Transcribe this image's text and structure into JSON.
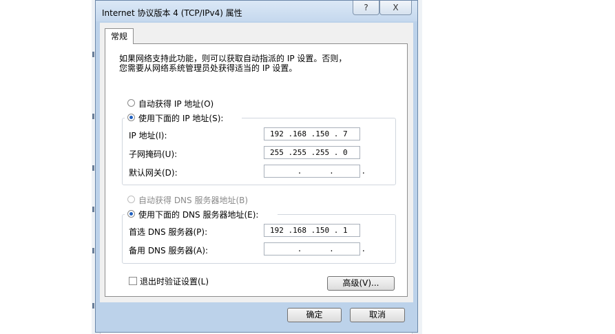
{
  "window": {
    "title": "Internet 协议版本 4 (TCP/IPv4) 属性",
    "help_label": "?",
    "close_label": "X"
  },
  "tabs": [
    {
      "label": "常规"
    }
  ],
  "description": {
    "line1": "如果网络支持此功能，则可以获取自动指派的 IP 设置。否则，",
    "line2": "您需要从网络系统管理员处获得适当的 IP 设置。"
  },
  "ip_section": {
    "auto_label": "自动获得 IP 地址(O)",
    "manual_label": "使用下面的 IP 地址(S):",
    "fields": [
      {
        "label": "IP 地址(I):",
        "value": "192 .168 .150 . 7"
      },
      {
        "label": "子网掩码(U):",
        "value": "255 .255 .255 . 0"
      },
      {
        "label": "默认网关(D):",
        "value": "      .      .      ."
      }
    ]
  },
  "dns_section": {
    "auto_label": "自动获得 DNS 服务器地址(B)",
    "manual_label": "使用下面的 DNS 服务器地址(E):",
    "fields": [
      {
        "label": "首选 DNS 服务器(P):",
        "value": "192 .168 .150 . 1"
      },
      {
        "label": "备用 DNS 服务器(A):",
        "value": "      .      .      ."
      }
    ]
  },
  "validate_label": "退出时验证设置(L)",
  "advanced_label": "高级(V)...",
  "ok_label": "确定",
  "cancel_label": "取消",
  "colors": {
    "title_bar": "#c5d8ee",
    "radio_dot": "#1f5fbf",
    "panel": "#f0f0f0"
  }
}
